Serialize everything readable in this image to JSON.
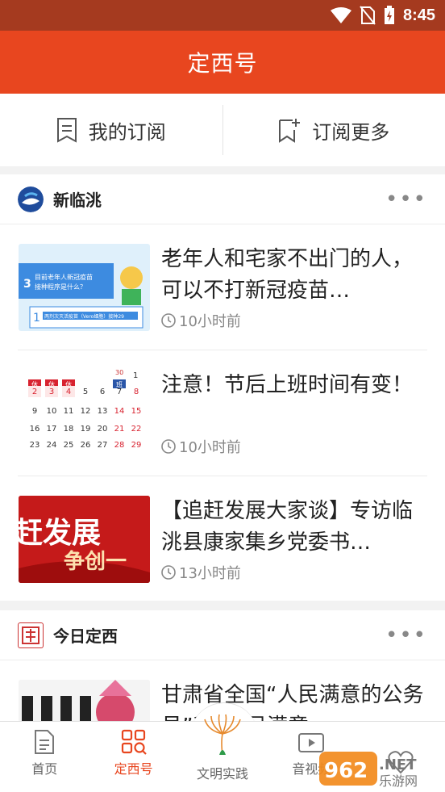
{
  "status_bar": {
    "time": "8:45"
  },
  "header": {
    "title": "定西号"
  },
  "subscription": {
    "my_label": "我的订阅",
    "more_label": "订阅更多"
  },
  "sections": [
    {
      "name": "新临洮",
      "items": [
        {
          "title": "老年人和宅家不出门的人，可以不打新冠疫苗…",
          "time": "10小时前"
        },
        {
          "title": "注意！节后上班时间有变！",
          "time": "10小时前"
        },
        {
          "title": "【追赶发展大家谈】专访临洮县康家集乡党委书…",
          "time": "13小时前"
        }
      ]
    },
    {
      "name": "今日定西",
      "items": [
        {
          "title": "甘肃省全国“人民满意的公务员”和“人民满意…",
          "time": ""
        }
      ]
    }
  ],
  "thumb_text": {
    "q1_num": "3",
    "q1_text": "目前老年人新冠疫苗\n接种程序是什么？",
    "q1_sub": "1",
    "q1_bar": "两剂次灭活疫苗（Vero细胞）接种29",
    "cal_row1": [
      "休",
      "休",
      "休",
      "",
      "",
      "班",
      ""
    ],
    "cal_days1": [
      "2",
      "3",
      "4",
      "5",
      "6",
      "7",
      "8"
    ],
    "cal_days2": [
      "9",
      "10",
      "11",
      "12",
      "13",
      "14",
      "15"
    ],
    "cal_days3": [
      "16",
      "17",
      "18",
      "19",
      "20",
      "21",
      "22"
    ],
    "cal_days4": [
      "23",
      "24",
      "25",
      "26",
      "27",
      "28",
      "29"
    ],
    "cal_top": [
      "30",
      "1"
    ],
    "banner_line1": "赶发展",
    "banner_line2": "争创一"
  },
  "tabbar": {
    "tabs": [
      {
        "label": "首页"
      },
      {
        "label": "定西号"
      },
      {
        "label": "文明实践"
      },
      {
        "label": "音视频"
      },
      {
        "label": ""
      }
    ]
  },
  "watermark": {
    "text": "962.NET",
    "sub": "乐游网"
  },
  "colors": {
    "brand": "#e8461f",
    "status_bar": "#a53a1f"
  }
}
